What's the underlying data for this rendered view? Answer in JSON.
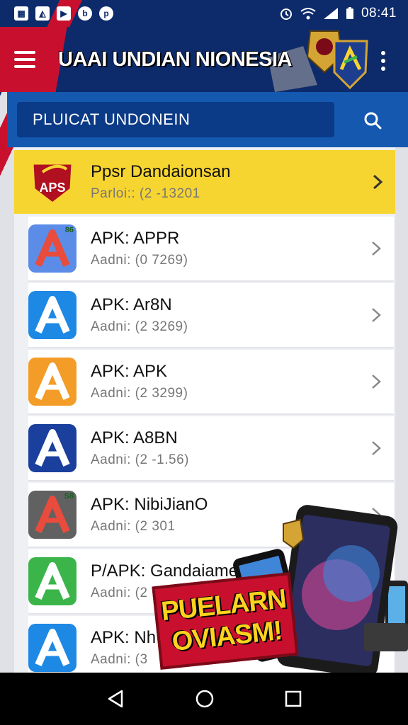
{
  "status_bar": {
    "left_icons": [
      "calendar-icon",
      "gallery-icon",
      "media-icon",
      "b-icon",
      "p-icon"
    ],
    "right_icons": [
      "alarm-icon",
      "wifi-icon",
      "signal-icon",
      "battery-icon"
    ],
    "time": "08:41"
  },
  "app_bar": {
    "title": "UAAI UNDIAN NIONESIA"
  },
  "search": {
    "placeholder": "PLUICAT UNDONEIN"
  },
  "featured": {
    "logo_text": "APS",
    "title": "Ppsr Dandaionsan",
    "subtitle": "Parloi:: (2 -13201"
  },
  "apps": [
    {
      "title": "APK: APPR",
      "subtitle": "Aadni: (0 7269)",
      "icon_color": "#e94b3c",
      "icon_bg": "#5b8de8",
      "corner_tag": "86"
    },
    {
      "title": "APK: Ar8N",
      "subtitle": "Aadni: (2 3269)",
      "icon_color": "#ffffff",
      "icon_bg": "#1e88e5",
      "corner_tag": ""
    },
    {
      "title": "APK: APK",
      "subtitle": "Aadni: (2 3299)",
      "icon_color": "#ffffff",
      "icon_bg": "#f39c27",
      "corner_tag": ""
    },
    {
      "title": "APK: A8BN",
      "subtitle": "Aadni: (2 -1.56)",
      "icon_color": "#ffffff",
      "icon_bg": "#1a3f9c",
      "corner_tag": ""
    },
    {
      "title": "APK: NibiJianO",
      "subtitle": "Aadni: (2 301",
      "icon_color": "#e94b3c",
      "icon_bg": "#616161",
      "corner_tag": "S8"
    },
    {
      "title": "P/APK: Gandaiamenan",
      "subtitle": "Aadni: (2",
      "icon_color": "#ffffff",
      "icon_bg": "#3bb54a",
      "corner_tag": ""
    },
    {
      "title": "APK: Nh",
      "subtitle": "Aadni: (3",
      "icon_color": "#ffffff",
      "icon_bg": "#1e88e5",
      "corner_tag": ""
    }
  ],
  "promo": {
    "line1": "PUELARN",
    "line2": "OVIASM!"
  },
  "nav": {
    "back": "back-icon",
    "home": "home-icon",
    "recents": "recents-icon"
  }
}
